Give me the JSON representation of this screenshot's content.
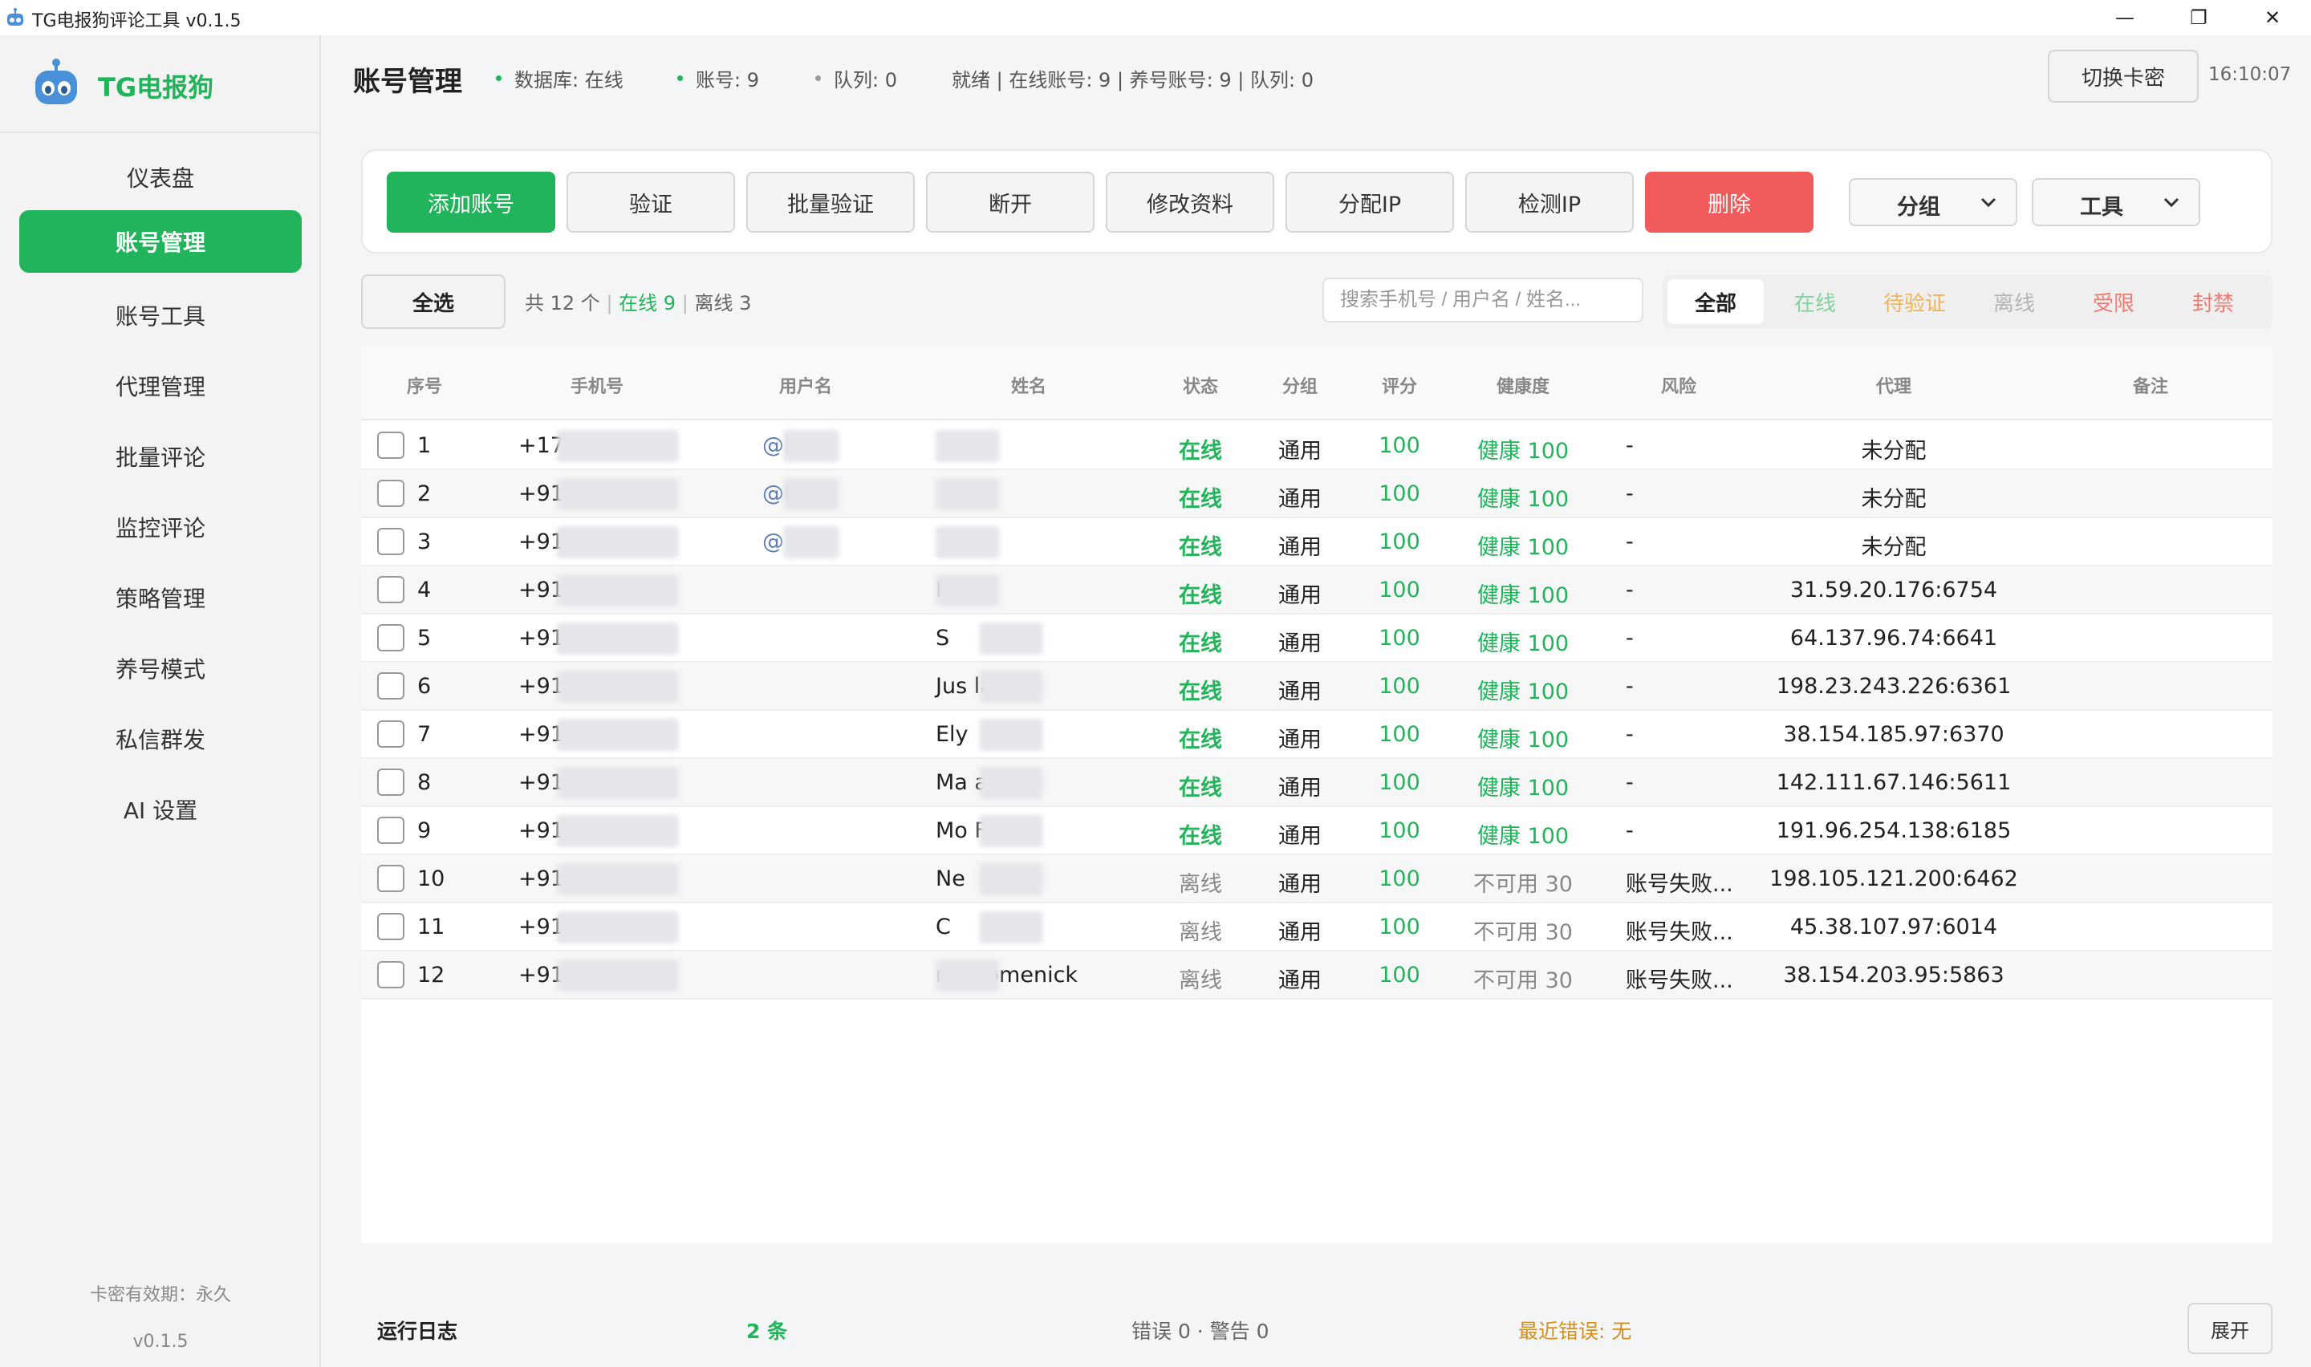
{
  "window": {
    "title": "TG电报狗评论工具 v0.1.5",
    "minimize": "—",
    "maximize": "❐",
    "close": "✕"
  },
  "brand": {
    "name": "TG电报狗"
  },
  "sidebar": {
    "items": [
      {
        "label": "仪表盘"
      },
      {
        "label": "账号管理",
        "active": true
      },
      {
        "label": "账号工具"
      },
      {
        "label": "代理管理"
      },
      {
        "label": "批量评论"
      },
      {
        "label": "监控评论"
      },
      {
        "label": "策略管理"
      },
      {
        "label": "养号模式"
      },
      {
        "label": "私信群发"
      },
      {
        "label": "AI 设置"
      }
    ],
    "license": "卡密有效期：永久",
    "version": "v0.1.5"
  },
  "header": {
    "title": "账号管理",
    "db_status": "数据库: 在线",
    "accounts": "账号: 9",
    "queue": "队列: 0",
    "status_line": "就绪 | 在线账号: 9 | 养号账号: 9 | 队列: 0",
    "switch_label": "切换卡密",
    "clock": "16:10:07"
  },
  "toolbar": {
    "add": "添加账号",
    "verify": "验证",
    "batch_verify": "批量验证",
    "disconnect": "断开",
    "edit_profile": "修改资料",
    "assign_ip": "分配IP",
    "check_ip": "检测IP",
    "delete": "删除",
    "group": "分组",
    "tools": "工具"
  },
  "filter": {
    "select_all": "全选",
    "total": "共 12 个",
    "online": "在线 9",
    "offline": "离线 3",
    "sep": "|",
    "search_placeholder": "搜索手机号 / 用户名 / 姓名...",
    "tabs": [
      {
        "label": "全部",
        "color": "#222222"
      },
      {
        "label": "在线",
        "color": "#7fd39b"
      },
      {
        "label": "待验证",
        "color": "#f0b357"
      },
      {
        "label": "离线",
        "color": "#b5b5b5"
      },
      {
        "label": "受限",
        "color": "#f07a72"
      },
      {
        "label": "封禁",
        "color": "#f07a72"
      }
    ]
  },
  "table": {
    "headers": [
      "序号",
      "手机号",
      "用户名",
      "姓名",
      "状态",
      "分组",
      "评分",
      "健康度",
      "风险",
      "代理",
      "备注"
    ],
    "rows": [
      {
        "no": "1",
        "phone": "+176",
        "user": "@b",
        "name": "",
        "status": "在线",
        "group": "通用",
        "score": "100",
        "health": "健康 100",
        "risk": "-",
        "proxy": "未分配"
      },
      {
        "no": "2",
        "phone": "+91",
        "user": "@l",
        "name": "",
        "status": "在线",
        "group": "通用",
        "score": "100",
        "health": "健康 100",
        "risk": "-",
        "proxy": "未分配"
      },
      {
        "no": "3",
        "phone": "+91",
        "user": "@",
        "name": "",
        "status": "在线",
        "group": "通用",
        "score": "100",
        "health": "健康 100",
        "risk": "-",
        "proxy": "未分配"
      },
      {
        "no": "4",
        "phone": "+91                0",
        "user": "",
        "name": "              Keefe",
        "status": "在线",
        "group": "通用",
        "score": "100",
        "health": "健康 100",
        "risk": "-",
        "proxy": "31.59.20.176:6754"
      },
      {
        "no": "5",
        "phone": "+91                7",
        "user": "",
        "name": "S",
        "status": "在线",
        "group": "通用",
        "score": "100",
        "health": "健康 100",
        "risk": "-",
        "proxy": "64.137.96.74:6641"
      },
      {
        "no": "6",
        "phone": "+91                2",
        "user": "",
        "name": "Jus          lauf",
        "status": "在线",
        "group": "通用",
        "score": "100",
        "health": "健康 100",
        "risk": "-",
        "proxy": "198.23.243.226:6361"
      },
      {
        "no": "7",
        "phone": "+91                5",
        "user": "",
        "name": "Ely",
        "status": "在线",
        "group": "通用",
        "score": "100",
        "health": "健康 100",
        "risk": "-",
        "proxy": "38.154.185.97:6370"
      },
      {
        "no": "8",
        "phone": "+918",
        "user": "",
        "name": "Ma          anton",
        "status": "在线",
        "group": "通用",
        "score": "100",
        "health": "健康 100",
        "risk": "-",
        "proxy": "142.111.67.146:5611"
      },
      {
        "no": "9",
        "phone": "+918",
        "user": "",
        "name": "Mo        Ferry",
        "status": "在线",
        "group": "通用",
        "score": "100",
        "health": "健康 100",
        "risk": "-",
        "proxy": "191.96.254.138:6185"
      },
      {
        "no": "10",
        "phone": "+918",
        "user": "",
        "name": "Ne",
        "status": "离线",
        "group": "通用",
        "score": "100",
        "health": "不可用 30",
        "risk": "账号失败...",
        "proxy": "198.105.121.200:6462"
      },
      {
        "no": "11",
        "phone": "+918             92",
        "user": "",
        "name": "C",
        "status": "离线",
        "group": "通用",
        "score": "100",
        "health": "不可用 30",
        "risk": "账号失败...",
        "proxy": "45.38.107.97:6014"
      },
      {
        "no": "12",
        "phone": "+918       8      017",
        "user": "",
        "name": "        na Homenick",
        "status": "离线",
        "group": "通用",
        "score": "100",
        "health": "不可用 30",
        "risk": "账号失败...",
        "proxy": "38.154.203.95:5863"
      }
    ]
  },
  "log": {
    "title": "运行日志",
    "count": "2 条",
    "errors": "错误 0 · 警告 0",
    "recent_error": "最近错误: 无",
    "expand": "展开"
  },
  "colors": {
    "accent": "#22b45a",
    "danger": "#f15b5b",
    "warning": "#d4901e"
  }
}
